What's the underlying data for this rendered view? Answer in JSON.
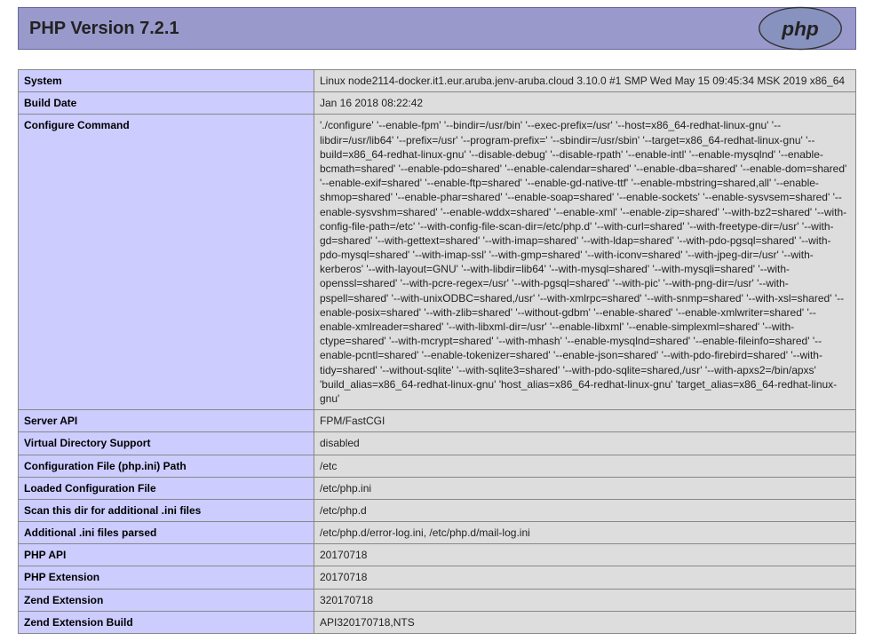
{
  "header": {
    "title": "PHP Version 7.2.1"
  },
  "rows": [
    {
      "label": "System",
      "value": "Linux node2114-docker.it1.eur.aruba.jenv-aruba.cloud 3.10.0 #1 SMP Wed May 15 09:45:34 MSK 2019 x86_64"
    },
    {
      "label": "Build Date",
      "value": "Jan 16 2018 08:22:42"
    },
    {
      "label": "Configure Command",
      "value": "'./configure' '--enable-fpm' '--bindir=/usr/bin' '--exec-prefix=/usr' '--host=x86_64-redhat-linux-gnu' '--libdir=/usr/lib64' '--prefix=/usr' '--program-prefix=' '--sbindir=/usr/sbin' '--target=x86_64-redhat-linux-gnu' '--build=x86_64-redhat-linux-gnu' '--disable-debug' '--disable-rpath' '--enable-intl' '--enable-mysqlnd' '--enable-bcmath=shared' '--enable-pdo=shared' '--enable-calendar=shared' '--enable-dba=shared' '--enable-dom=shared' '--enable-exif=shared' '--enable-ftp=shared' '--enable-gd-native-ttf' '--enable-mbstring=shared,all' '--enable-shmop=shared' '--enable-phar=shared' '--enable-soap=shared' '--enable-sockets' '--enable-sysvsem=shared' '--enable-sysvshm=shared' '--enable-wddx=shared' '--enable-xml' '--enable-zip=shared' '--with-bz2=shared' '--with-config-file-path=/etc' '--with-config-file-scan-dir=/etc/php.d' '--with-curl=shared' '--with-freetype-dir=/usr' '--with-gd=shared' '--with-gettext=shared' '--with-imap=shared' '--with-ldap=shared' '--with-pdo-pgsql=shared' '--with-pdo-mysql=shared' '--with-imap-ssl' '--with-gmp=shared' '--with-iconv=shared' '--with-jpeg-dir=/usr' '--with-kerberos' '--with-layout=GNU' '--with-libdir=lib64' '--with-mysql=shared' '--with-mysqli=shared' '--with-openssl=shared' '--with-pcre-regex=/usr' '--with-pgsql=shared' '--with-pic' '--with-png-dir=/usr' '--with-pspell=shared' '--with-unixODBC=shared,/usr' '--with-xmlrpc=shared' '--with-snmp=shared' '--with-xsl=shared' '--enable-posix=shared' '--with-zlib=shared' '--without-gdbm' '--enable-shared' '--enable-xmlwriter=shared' '--enable-xmlreader=shared' '--with-libxml-dir=/usr' '--enable-libxml' '--enable-simplexml=shared' '--with-ctype=shared' '--with-mcrypt=shared' '--with-mhash' '--enable-mysqlnd=shared' '--enable-fileinfo=shared' '--enable-pcntl=shared' '--enable-tokenizer=shared' '--enable-json=shared' '--with-pdo-firebird=shared' '--with-tidy=shared' '--without-sqlite' '--with-sqlite3=shared' '--with-pdo-sqlite=shared,/usr' '--with-apxs2=/bin/apxs' 'build_alias=x86_64-redhat-linux-gnu' 'host_alias=x86_64-redhat-linux-gnu' 'target_alias=x86_64-redhat-linux-gnu'"
    },
    {
      "label": "Server API",
      "value": "FPM/FastCGI"
    },
    {
      "label": "Virtual Directory Support",
      "value": "disabled"
    },
    {
      "label": "Configuration File (php.ini) Path",
      "value": "/etc"
    },
    {
      "label": "Loaded Configuration File",
      "value": "/etc/php.ini"
    },
    {
      "label": "Scan this dir for additional .ini files",
      "value": "/etc/php.d"
    },
    {
      "label": "Additional .ini files parsed",
      "value": "/etc/php.d/error-log.ini, /etc/php.d/mail-log.ini"
    },
    {
      "label": "PHP API",
      "value": "20170718"
    },
    {
      "label": "PHP Extension",
      "value": "20170718"
    },
    {
      "label": "Zend Extension",
      "value": "320170718"
    },
    {
      "label": "Zend Extension Build",
      "value": "API320170718,NTS"
    }
  ]
}
